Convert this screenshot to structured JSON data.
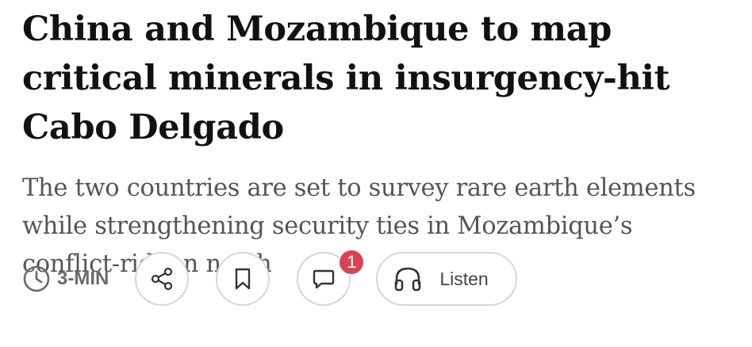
{
  "article": {
    "headline": "China and Mozambique to map critical minerals in insurgency-hit Cabo Delgado",
    "subheadline": "The two countries are set to survey rare earth elements while strengthening security ties in Mozambique’s conflict-ridden north"
  },
  "actions": {
    "read_time": "3-MIN",
    "read_time_icon": "clock-icon",
    "share_icon": "share-icon",
    "bookmark_icon": "bookmark-icon",
    "comment_icon": "comment-icon",
    "comment_count": "1",
    "listen_icon": "headphones-icon",
    "listen_label": "Listen"
  },
  "colors": {
    "headline": "#111111",
    "subheadline": "#555555",
    "icon_gray": "#6b6b6b",
    "border": "#d6d6d6",
    "badge": "#d94452"
  }
}
